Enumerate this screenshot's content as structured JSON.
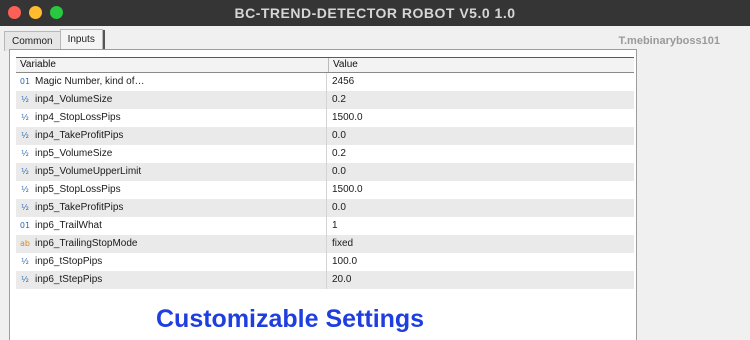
{
  "window": {
    "title": "BC-TREND-DETECTOR ROBOT V5.0 1.0"
  },
  "tabs": [
    {
      "label": "Common"
    },
    {
      "label": "Inputs"
    }
  ],
  "watermark": "T.mebinaryboss101",
  "table": {
    "headers": {
      "variable": "Variable",
      "value": "Value"
    },
    "rows": [
      {
        "icon": "01",
        "type_icon": "integer-icon",
        "variable": "Magic Number, kind of…",
        "value": "2456"
      },
      {
        "icon": "½",
        "type_icon": "double-icon",
        "variable": "inp4_VolumeSize",
        "value": "0.2"
      },
      {
        "icon": "½",
        "type_icon": "double-icon",
        "variable": "inp4_StopLossPips",
        "value": "1500.0"
      },
      {
        "icon": "½",
        "type_icon": "double-icon",
        "variable": "inp4_TakeProfitPips",
        "value": "0.0"
      },
      {
        "icon": "½",
        "type_icon": "double-icon",
        "variable": "inp5_VolumeSize",
        "value": "0.2"
      },
      {
        "icon": "½",
        "type_icon": "double-icon",
        "variable": "inp5_VolumeUpperLimit",
        "value": "0.0"
      },
      {
        "icon": "½",
        "type_icon": "double-icon",
        "variable": "inp5_StopLossPips",
        "value": "1500.0"
      },
      {
        "icon": "½",
        "type_icon": "double-icon",
        "variable": "inp5_TakeProfitPips",
        "value": "0.0"
      },
      {
        "icon": "01",
        "type_icon": "integer-icon",
        "variable": "inp6_TrailWhat",
        "value": "1"
      },
      {
        "icon": "ab",
        "type_icon": "string-icon",
        "variable": "inp6_TrailingStopMode",
        "value": "fixed"
      },
      {
        "icon": "½",
        "type_icon": "double-icon",
        "variable": "inp6_tStopPips",
        "value": "100.0"
      },
      {
        "icon": "½",
        "type_icon": "double-icon",
        "variable": "inp6_tStepPips",
        "value": "20.0"
      }
    ]
  },
  "overlay_text": "Customizable Settings",
  "colors": {
    "titlebar": "#353535",
    "overlay_text": "#1f3ee0",
    "alt_row": "#eaeaea"
  }
}
